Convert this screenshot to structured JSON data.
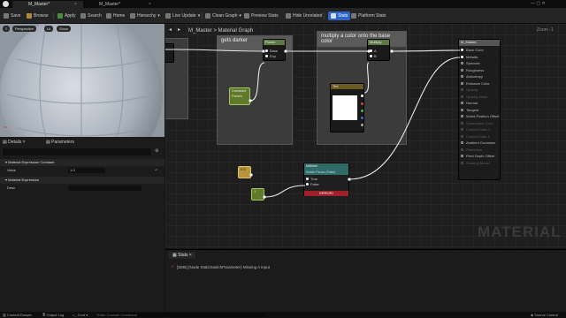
{
  "tabs": [
    {
      "label": "M_Master*",
      "active": true
    },
    {
      "label": "M_Master*",
      "active": false
    }
  ],
  "toolbar": {
    "save": "Save",
    "browse": "Browse",
    "apply": "Apply",
    "search": "Search",
    "home": "Home",
    "hierarchy": "Hierarchy",
    "live_update": "Live Update",
    "clean_graph": "Clean Graph",
    "preview_stats": "Preview Stats",
    "hide_unrelated": "Hide Unrelated",
    "stats": "Stats",
    "platform_stats": "Platform Stats"
  },
  "viewport": {
    "perspective": "Perspective",
    "lit": "Lit",
    "show": "Show"
  },
  "details": {
    "tab_details": "Details",
    "tab_parameters": "Parameters",
    "section_constant": "Material Expression Constant",
    "value_label": "Value",
    "value": "1.0",
    "section_expression": "Material Expression",
    "desc_label": "Desc"
  },
  "graph": {
    "title": "M_Master",
    "breadcrumb": "Material Graph",
    "zoom": "Zoom -1",
    "watermark": "MATERIAL",
    "comment1": "gets darker",
    "comment2": "multiply a color onto the base color",
    "power_node": "Power",
    "power_pins": [
      "Base",
      "Exp"
    ],
    "multiply_node": "Multiply",
    "multiply_pins": [
      "A",
      "B"
    ],
    "constant_node": "Constant",
    "constant_value": "Param",
    "vector_node": "Tint",
    "param_node": "0.5",
    "param_node2": "1",
    "switch_node": "isMetal",
    "switch_sub": "Switch Param (False)",
    "switch_pins": [
      "True",
      "False"
    ],
    "switch_error": "ERROR!",
    "result_node": "M_Master",
    "result_pins": [
      {
        "label": "Base Color",
        "active": true
      },
      {
        "label": "Metallic",
        "active": true
      },
      {
        "label": "Specular",
        "active": true
      },
      {
        "label": "Roughness",
        "active": true
      },
      {
        "label": "Anisotropy",
        "active": true
      },
      {
        "label": "Emissive Color",
        "active": true
      },
      {
        "label": "Opacity",
        "active": false
      },
      {
        "label": "Opacity Mask",
        "active": false
      },
      {
        "label": "Normal",
        "active": true
      },
      {
        "label": "Tangent",
        "active": true
      },
      {
        "label": "World Position Offset",
        "active": true
      },
      {
        "label": "Subsurface Color",
        "active": false
      },
      {
        "label": "Custom Data 0",
        "active": false
      },
      {
        "label": "Custom Data 1",
        "active": false
      },
      {
        "label": "Ambient Occlusion",
        "active": true
      },
      {
        "label": "Refraction",
        "active": false
      },
      {
        "label": "Pixel Depth Offset",
        "active": true
      },
      {
        "label": "Shading Model",
        "active": false
      }
    ]
  },
  "stats": {
    "title": "Stats",
    "error": "[SM5] (Node StaticSwitchParameter) Missing A input"
  },
  "bottom": {
    "content_drawer": "Content Drawer",
    "output_log": "Output Log",
    "cmd": "Cmd",
    "console_placeholder": "Enter Console Command",
    "source_control": "Source Control"
  },
  "colors": {
    "accent": "#2e64c5",
    "error": "#c84a4a",
    "constant_node": "#5f7a2a",
    "param_node": "#b9953a"
  }
}
